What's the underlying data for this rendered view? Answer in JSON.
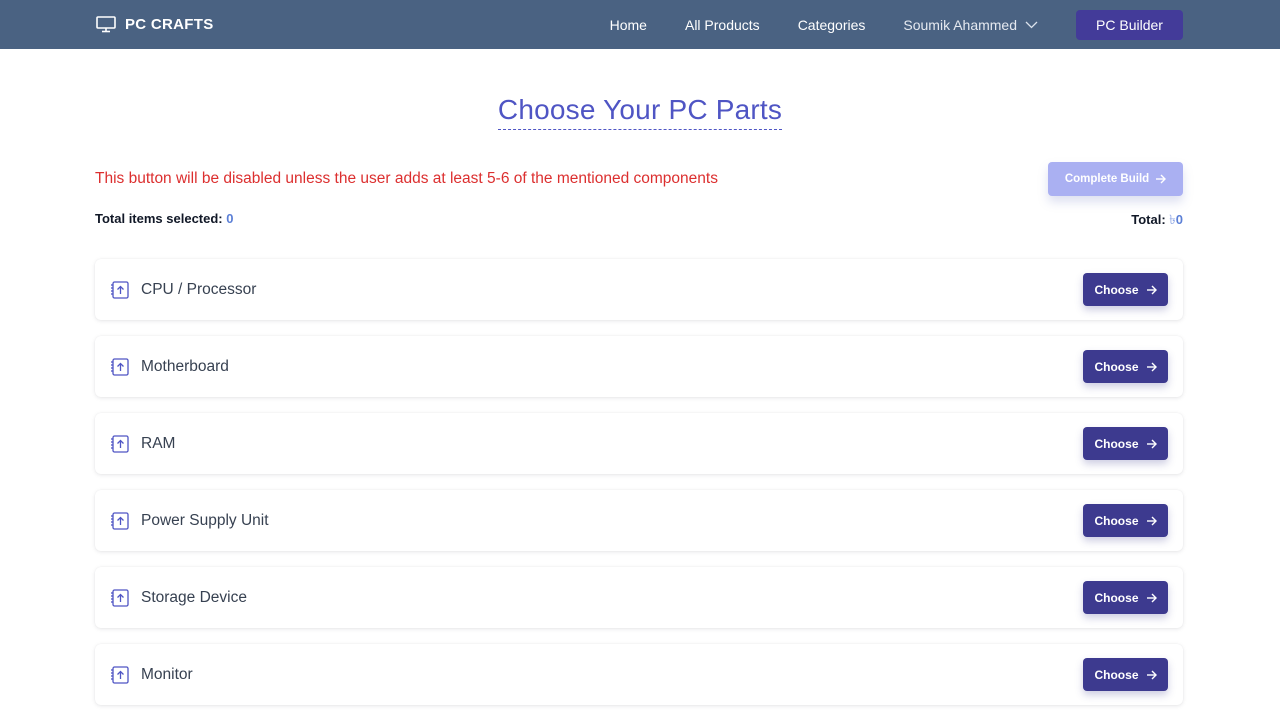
{
  "navbar": {
    "brand": "PC CRAFTS",
    "brand_icon": "monitor-icon",
    "links": [
      "Home",
      "All Products",
      "Categories"
    ],
    "user_name": "Soumik Ahammed",
    "builder_button": "PC Builder"
  },
  "main": {
    "title": "Choose Your PC Parts",
    "warning": "This button will be disabled unless the user adds at least 5-6 of the mentioned components",
    "complete_button": "Complete Build",
    "total_items_label": "Total items selected:",
    "total_items_value": "0",
    "total_label": "Total:",
    "currency_symbol": "৳",
    "total_value": "0",
    "components": [
      {
        "label": "CPU / Processor",
        "button": "Choose"
      },
      {
        "label": "Motherboard",
        "button": "Choose"
      },
      {
        "label": "RAM",
        "button": "Choose"
      },
      {
        "label": "Power Supply Unit",
        "button": "Choose"
      },
      {
        "label": "Storage Device",
        "button": "Choose"
      },
      {
        "label": "Monitor",
        "button": "Choose"
      }
    ]
  },
  "colors": {
    "navbar_bg": "#4a6282",
    "builder_button_bg": "#433b99",
    "title": "#4f55c4",
    "warning": "#dc2f2f",
    "complete_button_disabled": "#aab0f2",
    "choose_button_bg": "#3d3a8f"
  }
}
